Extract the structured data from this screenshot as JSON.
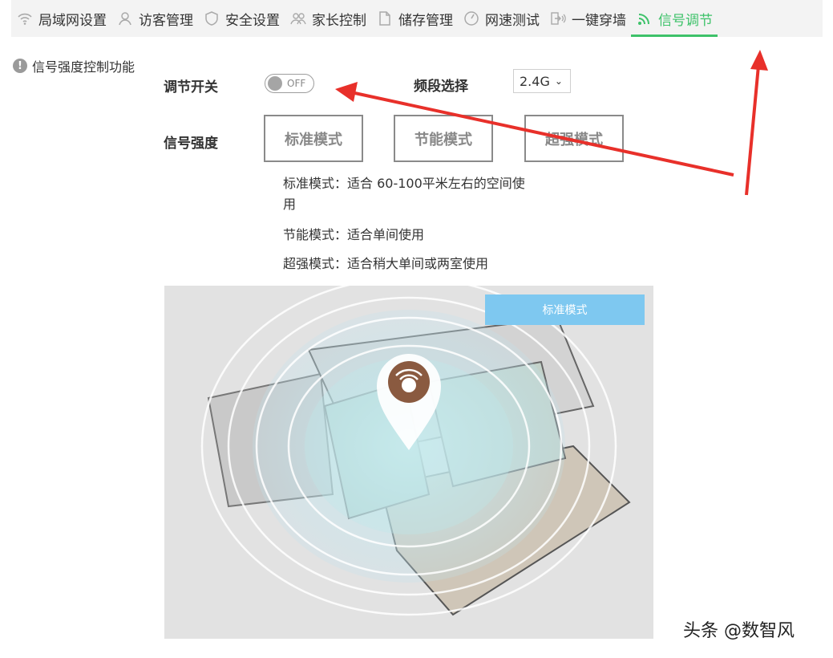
{
  "nav": {
    "items": [
      {
        "label": "局域网设置",
        "icon": "wifi-icon"
      },
      {
        "label": "访客管理",
        "icon": "user-icon"
      },
      {
        "label": "安全设置",
        "icon": "shield-icon"
      },
      {
        "label": "家长控制",
        "icon": "users-icon"
      },
      {
        "label": "储存管理",
        "icon": "file-icon"
      },
      {
        "label": "网速测试",
        "icon": "speedometer-icon"
      },
      {
        "label": "一键穿墙",
        "icon": "wall-signal-icon"
      },
      {
        "label": "信号调节",
        "icon": "signal-icon"
      }
    ],
    "active_index": 7
  },
  "section_title": "信号强度控制功能",
  "switch": {
    "label": "调节开关",
    "state": "OFF"
  },
  "band": {
    "label": "频段选择",
    "value": "2.4G"
  },
  "strength": {
    "label": "信号强度",
    "modes": [
      "标准模式",
      "节能模式",
      "超强模式"
    ]
  },
  "descriptions": {
    "standard_1": "标准模式：适合 60-100平米左右的空间使",
    "standard_2": "用",
    "saving": "节能模式：适合单间使用",
    "strong": "超强模式：适合稍大单间或两室使用"
  },
  "illustration": {
    "banner": "标准模式"
  },
  "watermark": "头条 @数智风",
  "colors": {
    "accent": "#3ec26a",
    "arrow": "#e8302a",
    "banner": "#7ec8f0"
  }
}
